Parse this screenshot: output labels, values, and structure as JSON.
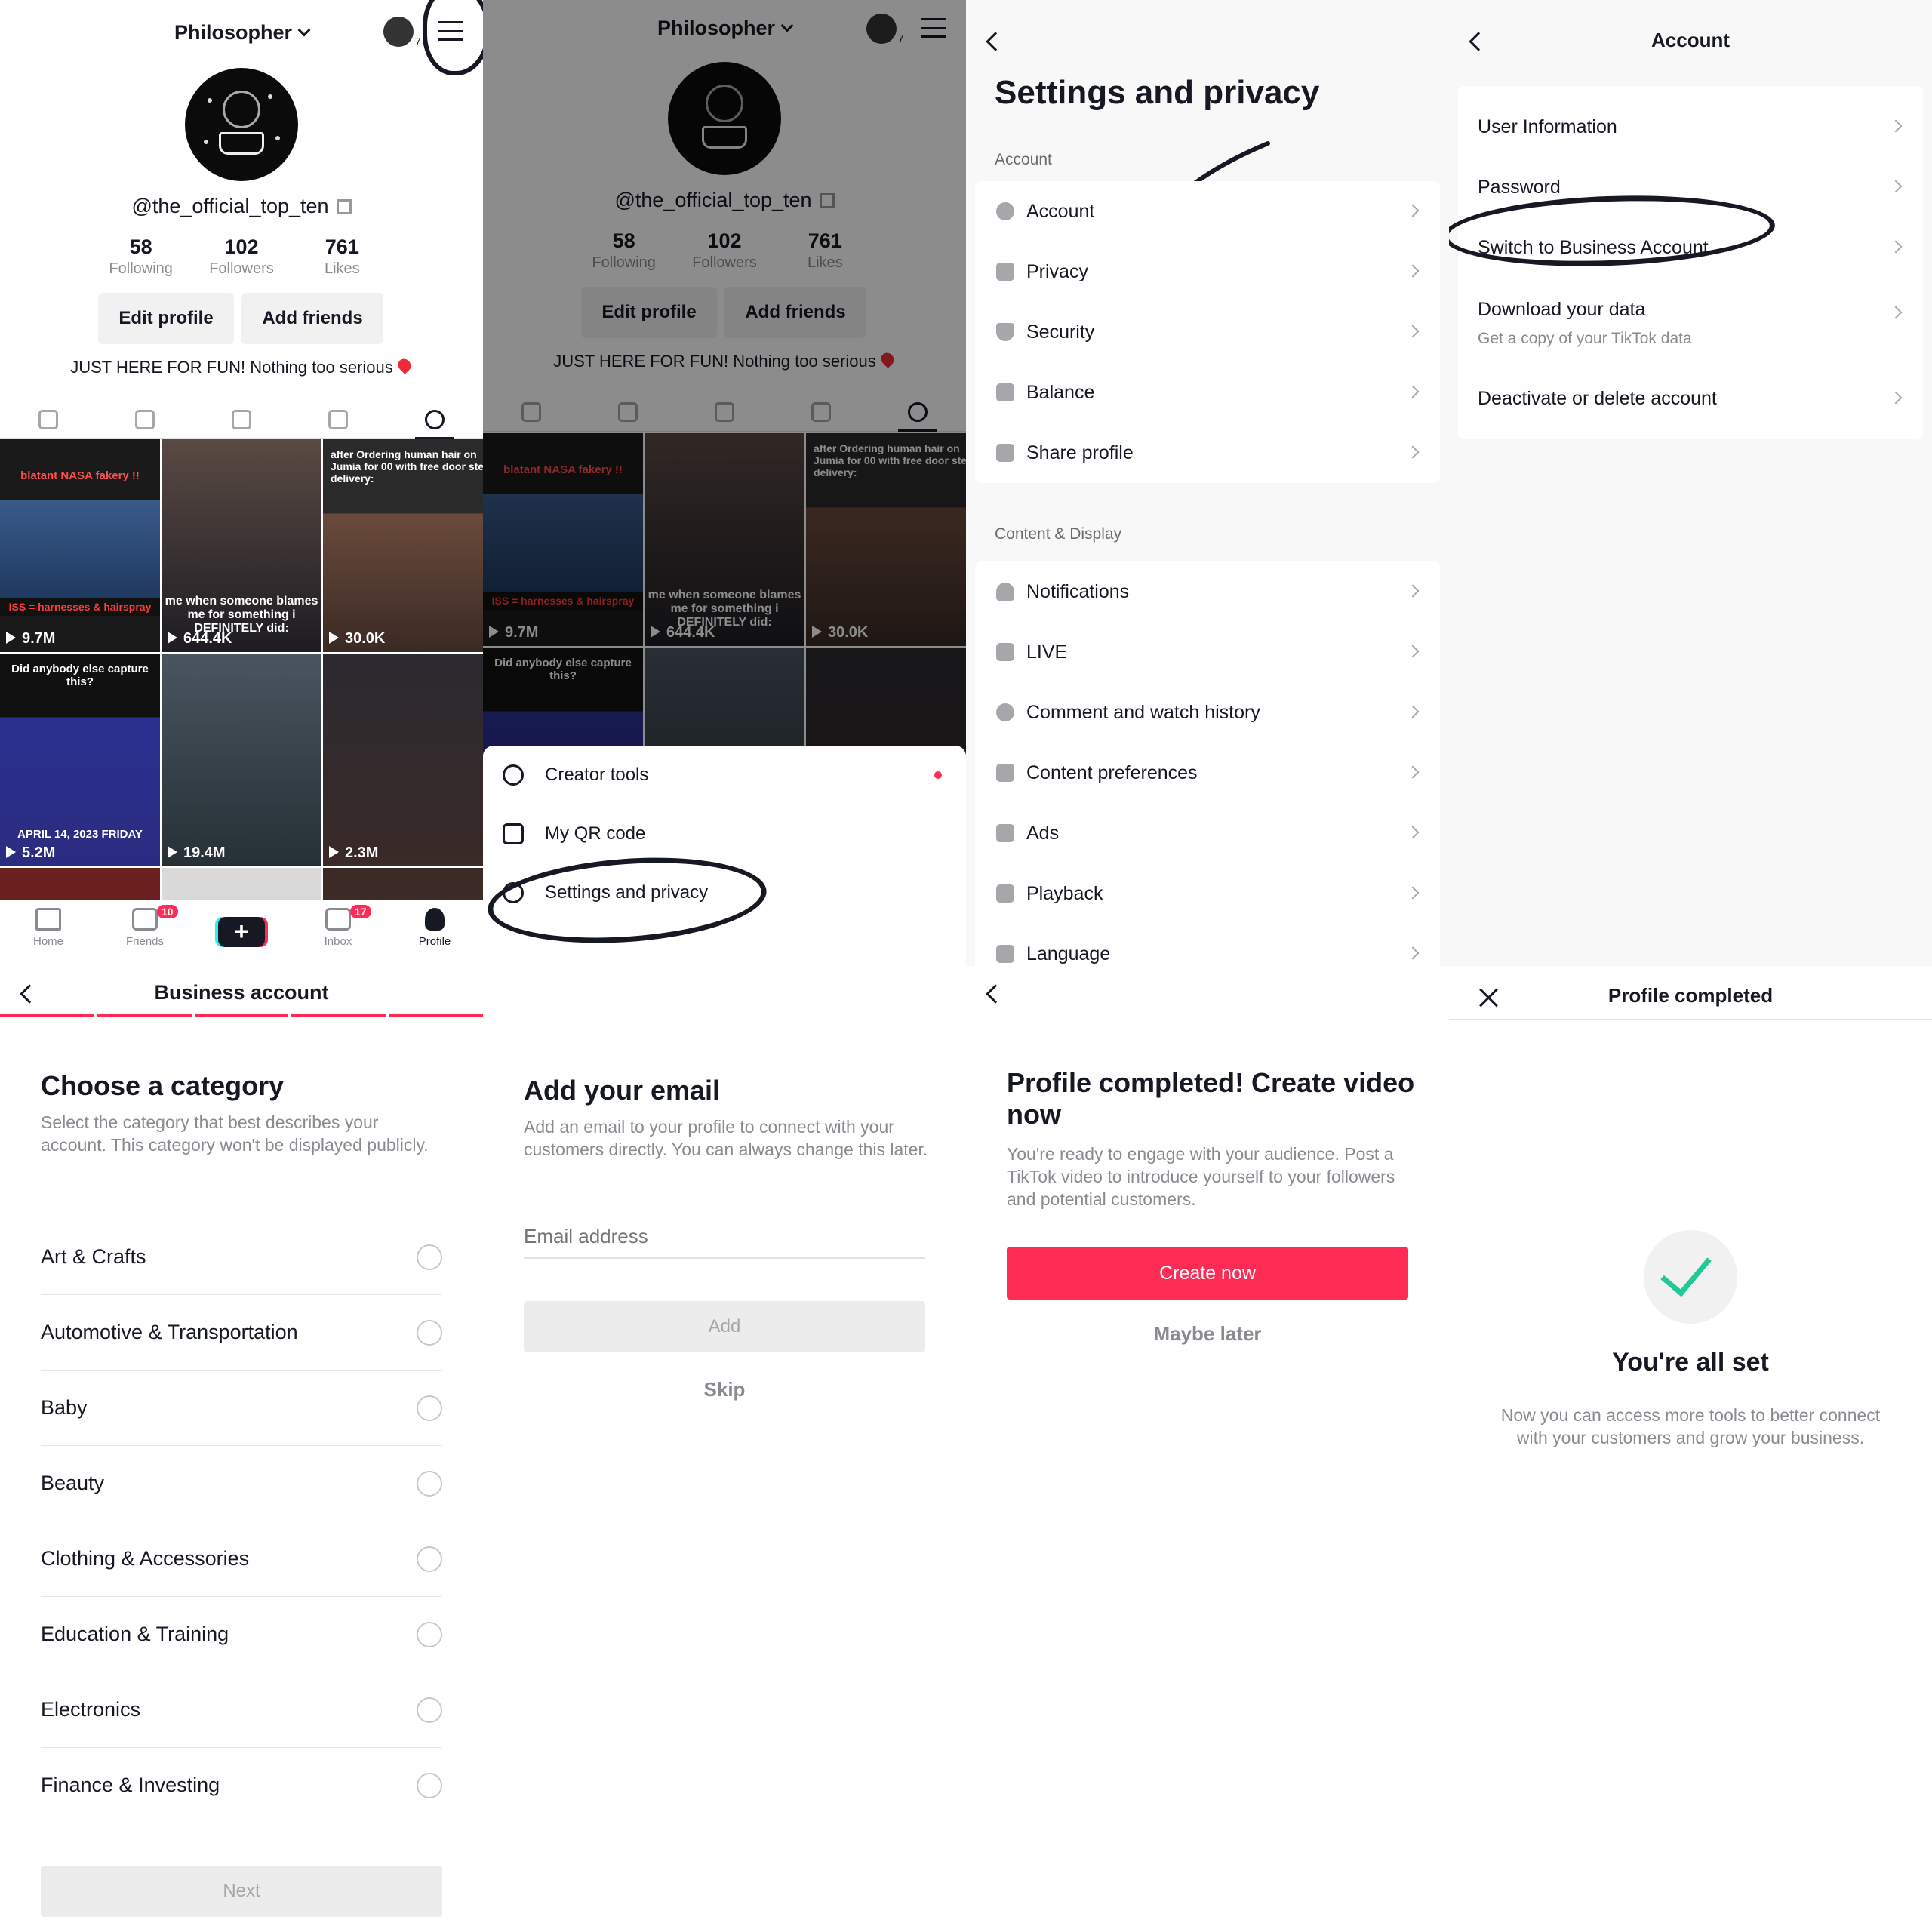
{
  "profile": {
    "username": "Philosopher",
    "avatar_badge": "7",
    "handle": "@the_official_top_ten",
    "stats": [
      {
        "num": "58",
        "label": "Following"
      },
      {
        "num": "102",
        "label": "Followers"
      },
      {
        "num": "761",
        "label": "Likes"
      }
    ],
    "edit_label": "Edit profile",
    "add_friends_label": "Add friends",
    "bio": "JUST HERE FOR FUN! Nothing too serious",
    "videos": [
      {
        "caption": "blatant NASA fakery !!",
        "sub": "ISS = harnesses & hairspray",
        "views": "9.7M"
      },
      {
        "caption": "me when someone blames me for something i DEFINITELY did:",
        "views": "644.4K"
      },
      {
        "caption": "after Ordering human hair on Jumia for 00 with free door step delivery:",
        "views": "30.0K"
      },
      {
        "caption": "Did anybody else capture this?",
        "foot": "APRIL 14, 2023 FRIDAY",
        "views": "5.2M"
      },
      {
        "caption": "",
        "views": "19.4M"
      },
      {
        "caption": "",
        "views": "2.3M"
      }
    ]
  },
  "nav": {
    "home": "Home",
    "friends": "Friends",
    "friends_badge": "10",
    "inbox": "Inbox",
    "inbox_badge": "17",
    "profile": "Profile",
    "plus": "+"
  },
  "menu": {
    "creator_tools": "Creator tools",
    "qr": "My QR code",
    "settings": "Settings and privacy"
  },
  "settings": {
    "title": "Settings and privacy",
    "section_account": "Account",
    "account_items": [
      "Account",
      "Privacy",
      "Security",
      "Balance",
      "Share profile"
    ],
    "section_content": "Content & Display",
    "content_items": [
      "Notifications",
      "LIVE",
      "Comment and watch history",
      "Content preferences",
      "Ads",
      "Playback",
      "Language"
    ]
  },
  "account": {
    "title": "Account",
    "items": [
      "User Information",
      "Password",
      "Switch to Business Account",
      "Download your data",
      "Deactivate or delete account"
    ],
    "download_sub": "Get a copy of your TikTok data"
  },
  "business": {
    "title": "Business account",
    "heading": "Choose a category",
    "desc": "Select the category that best describes your account. This category won't be displayed publicly.",
    "categories": [
      "Art & Crafts",
      "Automotive & Transportation",
      "Baby",
      "Beauty",
      "Clothing & Accessories",
      "Education & Training",
      "Electronics",
      "Finance & Investing"
    ],
    "next": "Next"
  },
  "email": {
    "heading": "Add your email",
    "desc": "Add an email to your profile to connect with your customers directly. You can always change this later.",
    "placeholder": "Email address",
    "add": "Add",
    "skip": "Skip"
  },
  "complete": {
    "heading": "Profile completed! Create video now",
    "desc": "You're ready to engage with your audience. Post a TikTok video to introduce yourself to your followers and potential customers.",
    "create": "Create now",
    "later": "Maybe later"
  },
  "done": {
    "title": "Profile completed",
    "heading": "You're all set",
    "desc": "Now you can access more tools to better connect with your customers and grow your business."
  }
}
